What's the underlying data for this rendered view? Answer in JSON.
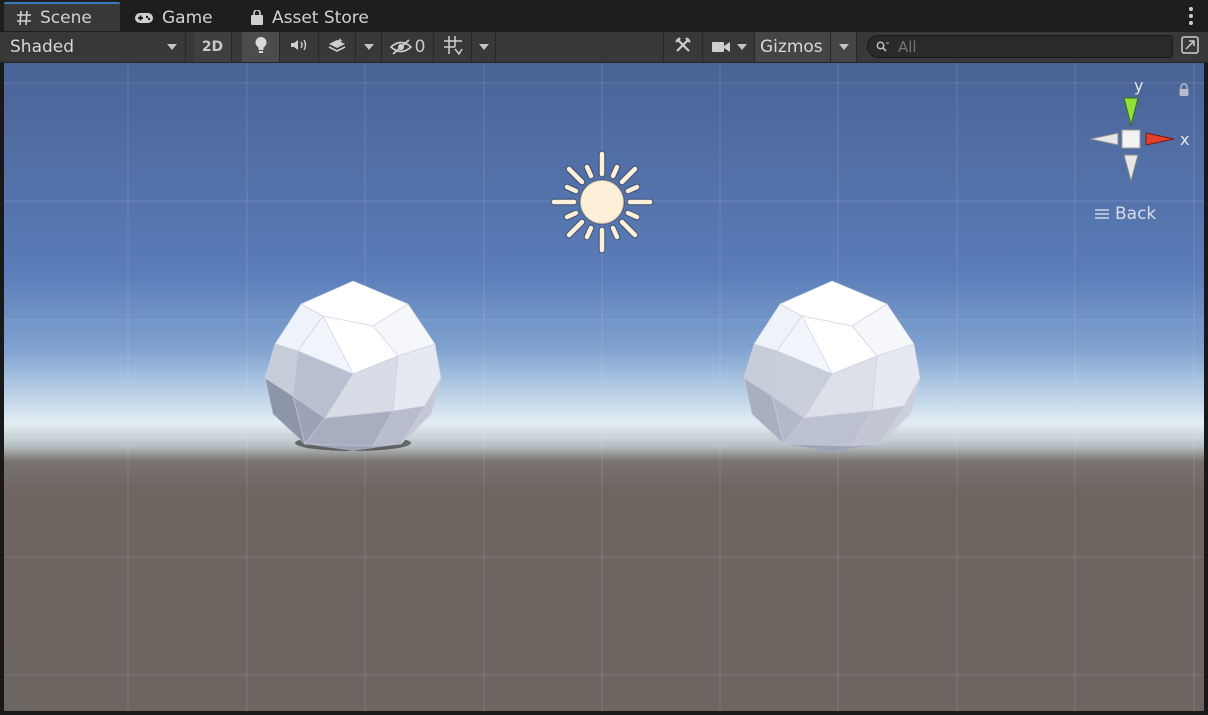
{
  "tabs": [
    {
      "label": "Scene",
      "icon": "hash-icon",
      "active": true
    },
    {
      "label": "Game",
      "icon": "gamepad-icon",
      "active": false
    },
    {
      "label": "Asset Store",
      "icon": "shopping-bag-icon",
      "active": false
    }
  ],
  "toolbar": {
    "draw_mode": "Shaded",
    "toggle_2d": "2D",
    "hidden_count": "0",
    "gizmos": "Gizmos",
    "search_placeholder": "All"
  },
  "viewport": {
    "orientation_gizmo": {
      "y_label": "y",
      "x_label": "x",
      "view": "Back"
    }
  },
  "colors": {
    "accent": "#3a79bb",
    "axis_y": "#8ee23a",
    "axis_x": "#e0402c",
    "sky_top": "#4a6396",
    "ground": "#6e6560"
  }
}
